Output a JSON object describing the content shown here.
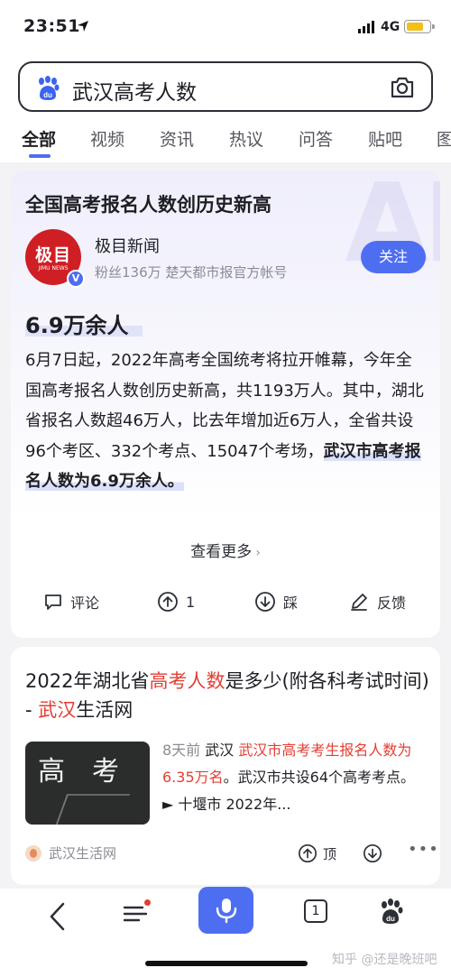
{
  "status_bar": {
    "time": "23:51",
    "network": "4G"
  },
  "search": {
    "query": "武汉高考人数"
  },
  "tabs": [
    {
      "label": "全部",
      "active": true
    },
    {
      "label": "视频"
    },
    {
      "label": "资讯"
    },
    {
      "label": "热议"
    },
    {
      "label": "问答"
    },
    {
      "label": "贴吧"
    },
    {
      "label": "图"
    }
  ],
  "card1": {
    "title": "全国高考报名人数创历史新高",
    "source": {
      "logo_text": "极目",
      "logo_sub": "JIMU NEWS",
      "name": "极目新闻",
      "meta": "粉丝136万  楚天都市报官方帐号",
      "verified_mark": "V"
    },
    "follow_label": "关注",
    "answer": "6.9万余人",
    "body_plain": "6月7日起，2022年高考全国统考将拉开帷幕，今年全国高考报名人数创历史新高，共1193万人。其中，湖北省报名人数超46万人，比去年增加近6万人，全省共设96个考区、332个考点、15047个考场，",
    "body_highlight": "武汉市高考报名人数为6.9万余人。",
    "more_label": "查看更多",
    "actions": {
      "comment": "评论",
      "like": "1",
      "dislike": "踩",
      "feedback": "反馈"
    }
  },
  "card2": {
    "title_parts": [
      "2022年湖北省",
      "高考人数",
      "是多少(附各科考试时间) - ",
      "武汉",
      "生活网"
    ],
    "thumb_text": [
      "高",
      "考"
    ],
    "snippet_date": "8天前",
    "snippet_parts": [
      "武汉 ",
      "武汉市高考考生报名人数为6.35万名",
      "。武汉市共设64个高考考点。 ► 十堰市 2022年..."
    ],
    "site": "武汉生活网",
    "top_label": "顶"
  },
  "bottom_bar": {
    "tabs_count": "1",
    "watermark": "知乎 @还是晚班吧"
  },
  "colors": {
    "accent": "#4e6ef2",
    "highlight_red": "#e33e33",
    "text": "#1e1f24",
    "muted": "#8a8c93"
  }
}
